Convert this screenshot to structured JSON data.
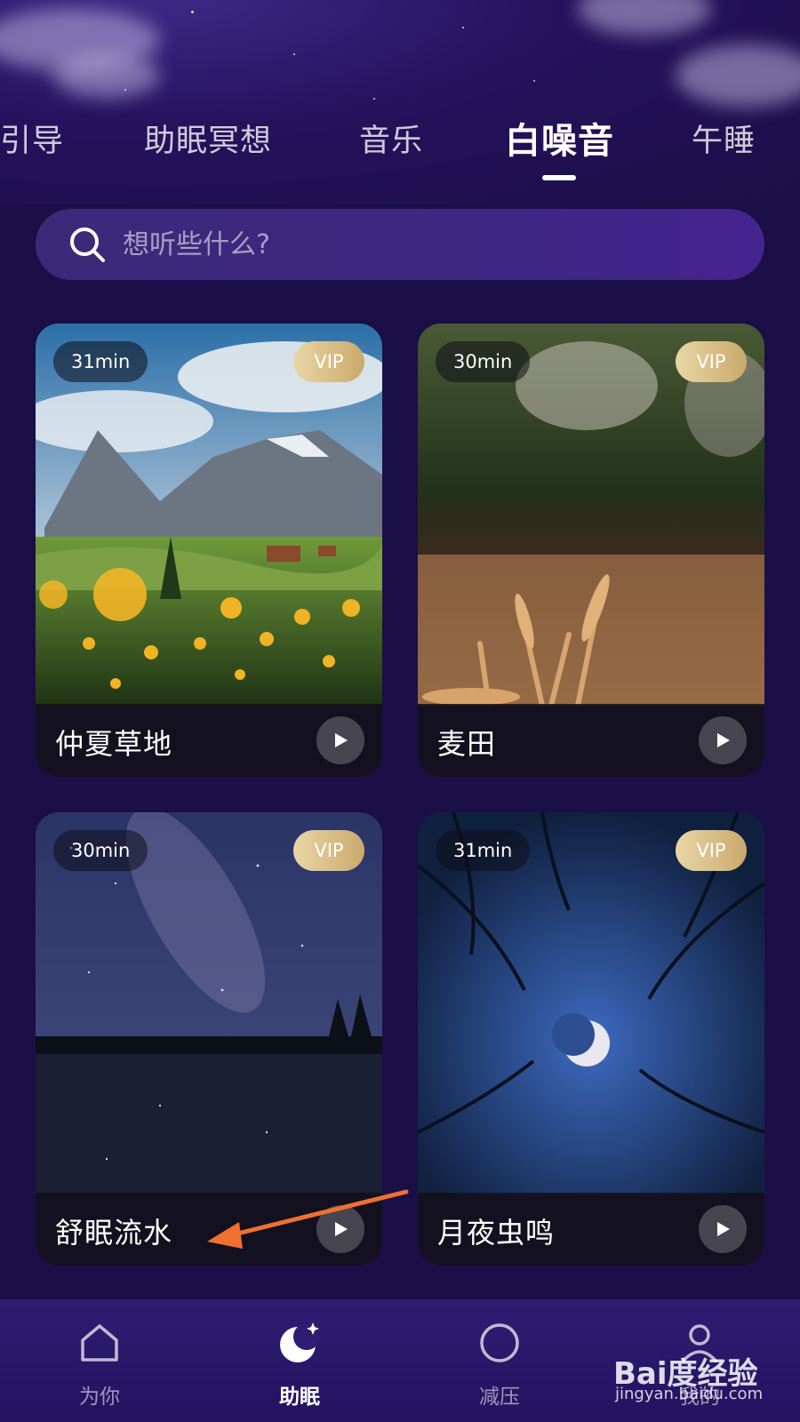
{
  "tabs": [
    {
      "label": "引导"
    },
    {
      "label": "助眠冥想"
    },
    {
      "label": "音乐"
    },
    {
      "label": "白噪音",
      "active": true
    },
    {
      "label": "午睡"
    }
  ],
  "search": {
    "placeholder": "想听些什么?"
  },
  "cards": [
    {
      "title": "仲夏草地",
      "duration": "31min",
      "badge": "VIP"
    },
    {
      "title": "麦田",
      "duration": "30min",
      "badge": "VIP"
    },
    {
      "title": "舒眠流水",
      "duration": "30min",
      "badge": "VIP"
    },
    {
      "title": "月夜虫鸣",
      "duration": "31min",
      "badge": "VIP"
    }
  ],
  "nav": [
    {
      "label": "为你",
      "icon": "home-icon"
    },
    {
      "label": "助眠",
      "icon": "moon-icon",
      "active": true
    },
    {
      "label": "减压",
      "icon": "circle-icon"
    },
    {
      "label": "我的",
      "icon": "profile-icon"
    }
  ],
  "watermark": {
    "brand": "Bai度经验",
    "url": "jingyan.baidu.com"
  },
  "colors": {
    "background": "#1b0f47",
    "nav": "#2d1e73",
    "vip_gold": "#c9a96b",
    "annotation_arrow": "#f07030"
  }
}
